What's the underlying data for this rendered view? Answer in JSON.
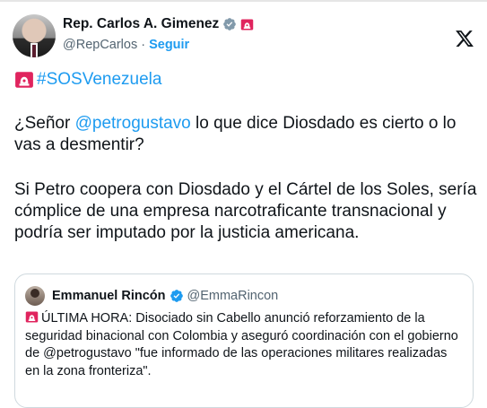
{
  "author": {
    "name": "Rep. Carlos A. Gimenez",
    "handle": "@RepCarlos",
    "separator": "·",
    "follow_label": "Seguir"
  },
  "tweet": {
    "hashtag": "#SOSVenezuela",
    "p1_before": "¿Señor ",
    "p1_mention": "@petrogustavo",
    "p1_after": " lo que dice Diosdado es cierto o lo vas a desmentir?",
    "p2": "Si Petro coopera con Diosdado y el Cártel de los Soles, sería cómplice de una empresa narcotraficante transnacional y podría ser imputado por la justicia americana."
  },
  "quote": {
    "name": "Emmanuel Rincón",
    "handle": "@EmmaRincon",
    "text": "ÚLTIMA HORA: Disociado sin Cabello anunció reforzamiento de la seguridad binacional con Colombia y aseguró coordinación con el gobierno de @petrogustavo \"fue informado de las operaciones militares realizadas en la zona fronteriza\"."
  },
  "colors": {
    "link": "#1d9bf0",
    "verified": "#829aab",
    "siren_red": "#e0245e",
    "secondary_text": "#536471"
  },
  "icons": [
    "verified-badge-icon",
    "siren-icon",
    "x-logo-icon"
  ]
}
